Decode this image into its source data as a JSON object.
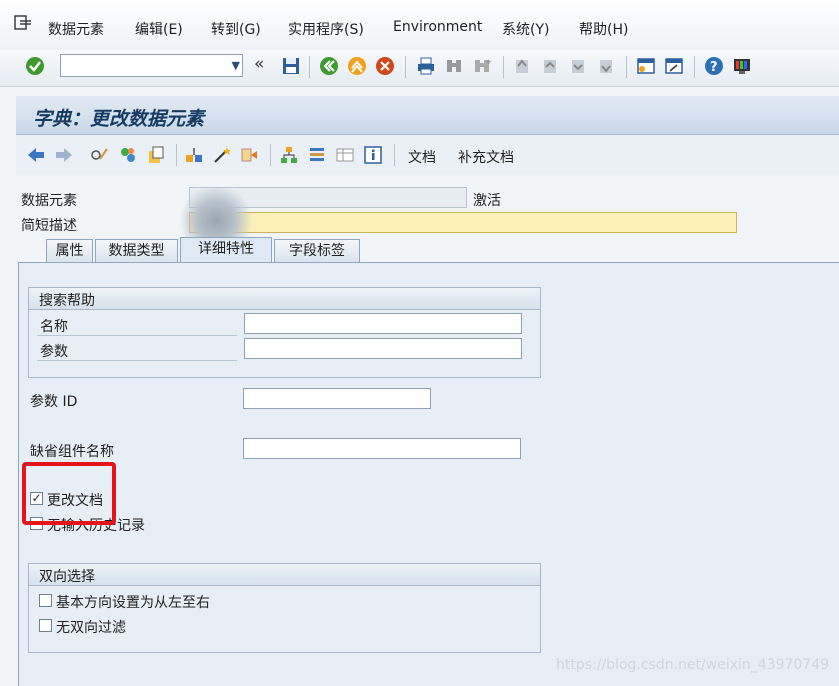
{
  "menu": {
    "items": [
      "数据元素",
      "编辑(E)",
      "转到(G)",
      "实用程序(S)",
      "Environment",
      "系统(Y)",
      "帮助(H)"
    ]
  },
  "toolbar": {
    "command_value": ""
  },
  "title": "字典：更改数据元素",
  "app_toolbar": {
    "doc_label": "文档",
    "supp_doc_label": "补充文档"
  },
  "header": {
    "data_element_label": "数据元素",
    "data_element_value": "",
    "status": "激活",
    "short_desc_label": "简短描述",
    "short_desc_value": ""
  },
  "tabs": [
    "属性",
    "数据类型",
    "详细特性",
    "字段标签"
  ],
  "active_tab": "详细特性",
  "search_help": {
    "title": "搜索帮助",
    "name_label": "名称",
    "param_label": "参数"
  },
  "param_id_label": "参数 ID",
  "default_component_label": "缺省组件名称",
  "change_doc": {
    "label": "更改文档",
    "checked": true
  },
  "no_history": {
    "label": "无输入历史记录",
    "checked": false
  },
  "bidi": {
    "title": "双向选择",
    "ltr_label": "基本方向设置为从左至右",
    "no_bidi_filter_label": "无双向过滤",
    "ltr_checked": false,
    "no_bidi_filter_checked": false
  },
  "watermark": "https://blog.csdn.net/weixin_43970749",
  "colors": {
    "highlight": "#e5141a",
    "title": "#173a63",
    "required_field": "#fbf1b6"
  }
}
